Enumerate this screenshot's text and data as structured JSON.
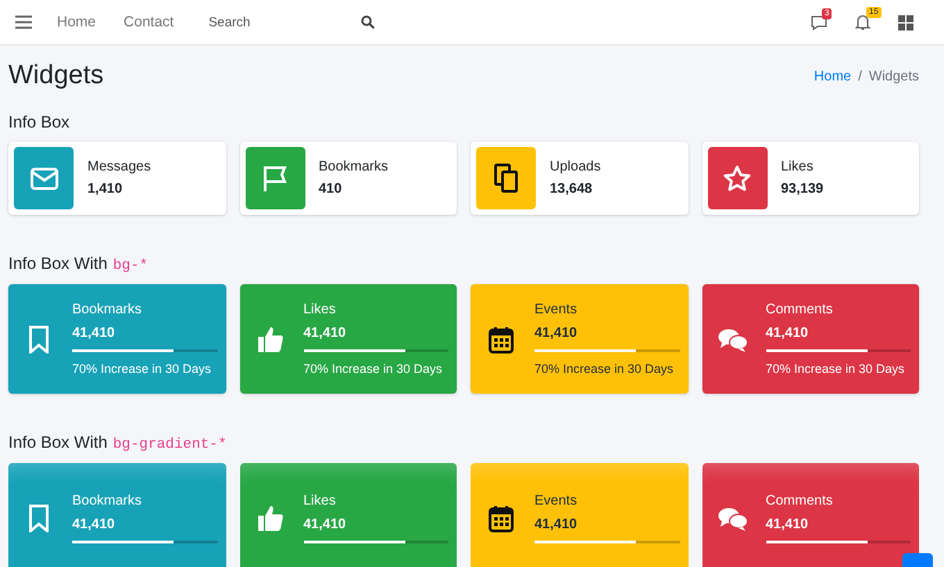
{
  "navbar": {
    "links": [
      "Home",
      "Contact"
    ],
    "search": {
      "placeholder": "Search"
    },
    "message_badge": "3",
    "notification_badge": "15"
  },
  "page": {
    "title": "Widgets",
    "breadcrumb": [
      {
        "label": "Home",
        "selected": false
      },
      {
        "label": "Widgets",
        "selected": true
      }
    ],
    "breadcrumb_separator": "/"
  },
  "sections": [
    {
      "heading": "Info Box",
      "boxes": [
        {
          "color": "#17a2b8",
          "label": "Messages",
          "value": "1,410"
        },
        {
          "color": "#28a745",
          "label": "Bookmarks",
          "value": "410"
        },
        {
          "color": "#ffc107",
          "label": "Uploads",
          "value": "13,648"
        },
        {
          "color": "#dc3545",
          "label": "Likes",
          "value": "93,139"
        }
      ]
    },
    {
      "heading": "Info Box With",
      "code": "bg-*",
      "boxes": [
        {
          "color": "#17a2b8",
          "label": "Bookmarks",
          "value": "41,410",
          "level": 0.7,
          "description": "70% Increase in 30 Days"
        },
        {
          "color": "#28a745",
          "label": "Likes",
          "value": "41,410",
          "level": 0.7,
          "description": "70% Increase in 30 Days"
        },
        {
          "color": "#ffc107",
          "label": "Events",
          "value": "41,410",
          "level": 0.7,
          "description": "70% Increase in 30 Days"
        },
        {
          "color": "#dc3545",
          "label": "Comments",
          "value": "41,410",
          "level": 0.7,
          "description": "70% Increase in 30 Days"
        }
      ]
    },
    {
      "heading": "Info Box With",
      "code": "bg-gradient-*",
      "boxes": [
        {
          "color": "#17a2b8",
          "label": "Bookmarks",
          "value": "41,410",
          "level": 0.7
        },
        {
          "color": "#28a745",
          "label": "Likes",
          "value": "41,410",
          "level": 0.7
        },
        {
          "color": "#ffc107",
          "label": "Events",
          "value": "41,410",
          "level": 0.7
        },
        {
          "color": "#dc3545",
          "label": "Comments",
          "value": "41,410",
          "level": 0.7
        }
      ]
    }
  ]
}
